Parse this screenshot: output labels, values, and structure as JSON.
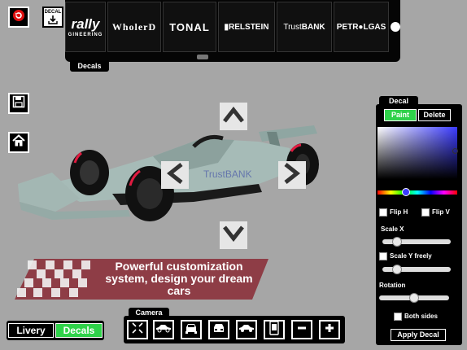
{
  "top_buttons": {
    "undo_icon": "undo-icon",
    "decal_import_label": "DECAL"
  },
  "decals_strip": {
    "tab_label": "Decals",
    "tiles": [
      {
        "label": "rally",
        "sub": "GINEERING"
      },
      {
        "label": "WholerD"
      },
      {
        "label": "TONAL"
      },
      {
        "label": "▮RELSTEIN"
      },
      {
        "label_light": "Trust",
        "label_bold": "BANK"
      },
      {
        "label": "PETR●LGAS"
      }
    ]
  },
  "side_buttons": {
    "save_icon": "save-icon",
    "home_icon": "home-icon"
  },
  "banner": {
    "text": "Powerful customization system, design your dream cars"
  },
  "car_decal_text": "TrustBANK",
  "decal_panel": {
    "tab_label": "Decal",
    "paint_label": "Paint",
    "delete_label": "Delete",
    "flip_h_label": "Flip H",
    "flip_v_label": "Flip V",
    "scale_x_label": "Scale X",
    "scale_x_value": 0.22,
    "scale_y_label": "Scale Y freely",
    "scale_y_value": 0.22,
    "rotation_label": "Rotation",
    "rotation_value": 0.5,
    "both_sides_label": "Both sides",
    "apply_label": "Apply Decal",
    "colors": {
      "active": "#2fd24a",
      "picker_base": "#3b3bff"
    }
  },
  "mode_toggle": {
    "livery_label": "Livery",
    "decals_label": "Decals",
    "active": "Decals"
  },
  "camera": {
    "tab_label": "Camera",
    "buttons": [
      "collapse-view-icon",
      "car-side-icon",
      "car-front-icon",
      "car-rear-icon",
      "car-top-icon",
      "phone-screenshot-icon",
      "zoom-out-icon",
      "zoom-in-icon"
    ]
  }
}
